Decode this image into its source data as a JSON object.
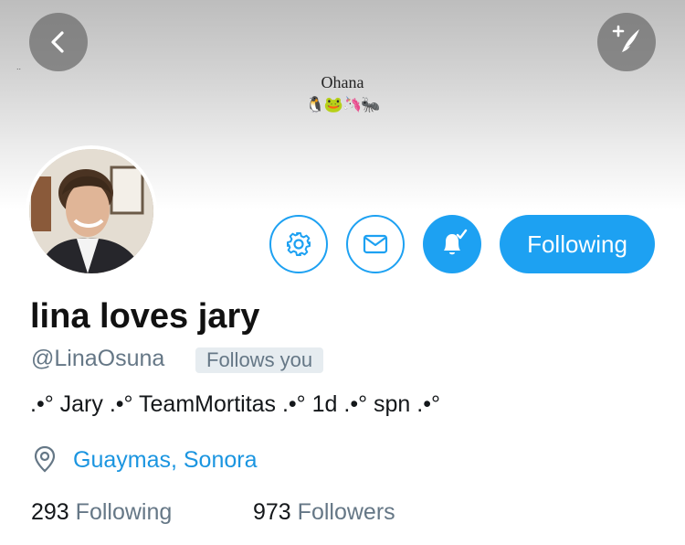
{
  "banner": {
    "title": "Ohana",
    "emoji": "🐧🐸🦄🐜",
    "dots": ".."
  },
  "profile": {
    "display_name": "lina loves jary",
    "handle": "@LinaOsuna",
    "follows_you_badge": "Follows you",
    "bio": ".•° Jary .•° TeamMortitas .•° 1d .•° spn .•°",
    "location": "Guaymas, Sonora"
  },
  "actions": {
    "following_label": "Following"
  },
  "stats": {
    "following_count": "293",
    "following_label": "Following",
    "followers_count": "973",
    "followers_label": "Followers"
  },
  "colors": {
    "accent": "#1da1f2",
    "link": "#1b95e0",
    "muted": "#657786",
    "badge_bg": "#e6ecf0"
  },
  "icons": [
    "back-arrow-icon",
    "compose-quill-icon",
    "gear-icon",
    "envelope-icon",
    "bell-check-icon",
    "location-pin-icon"
  ]
}
